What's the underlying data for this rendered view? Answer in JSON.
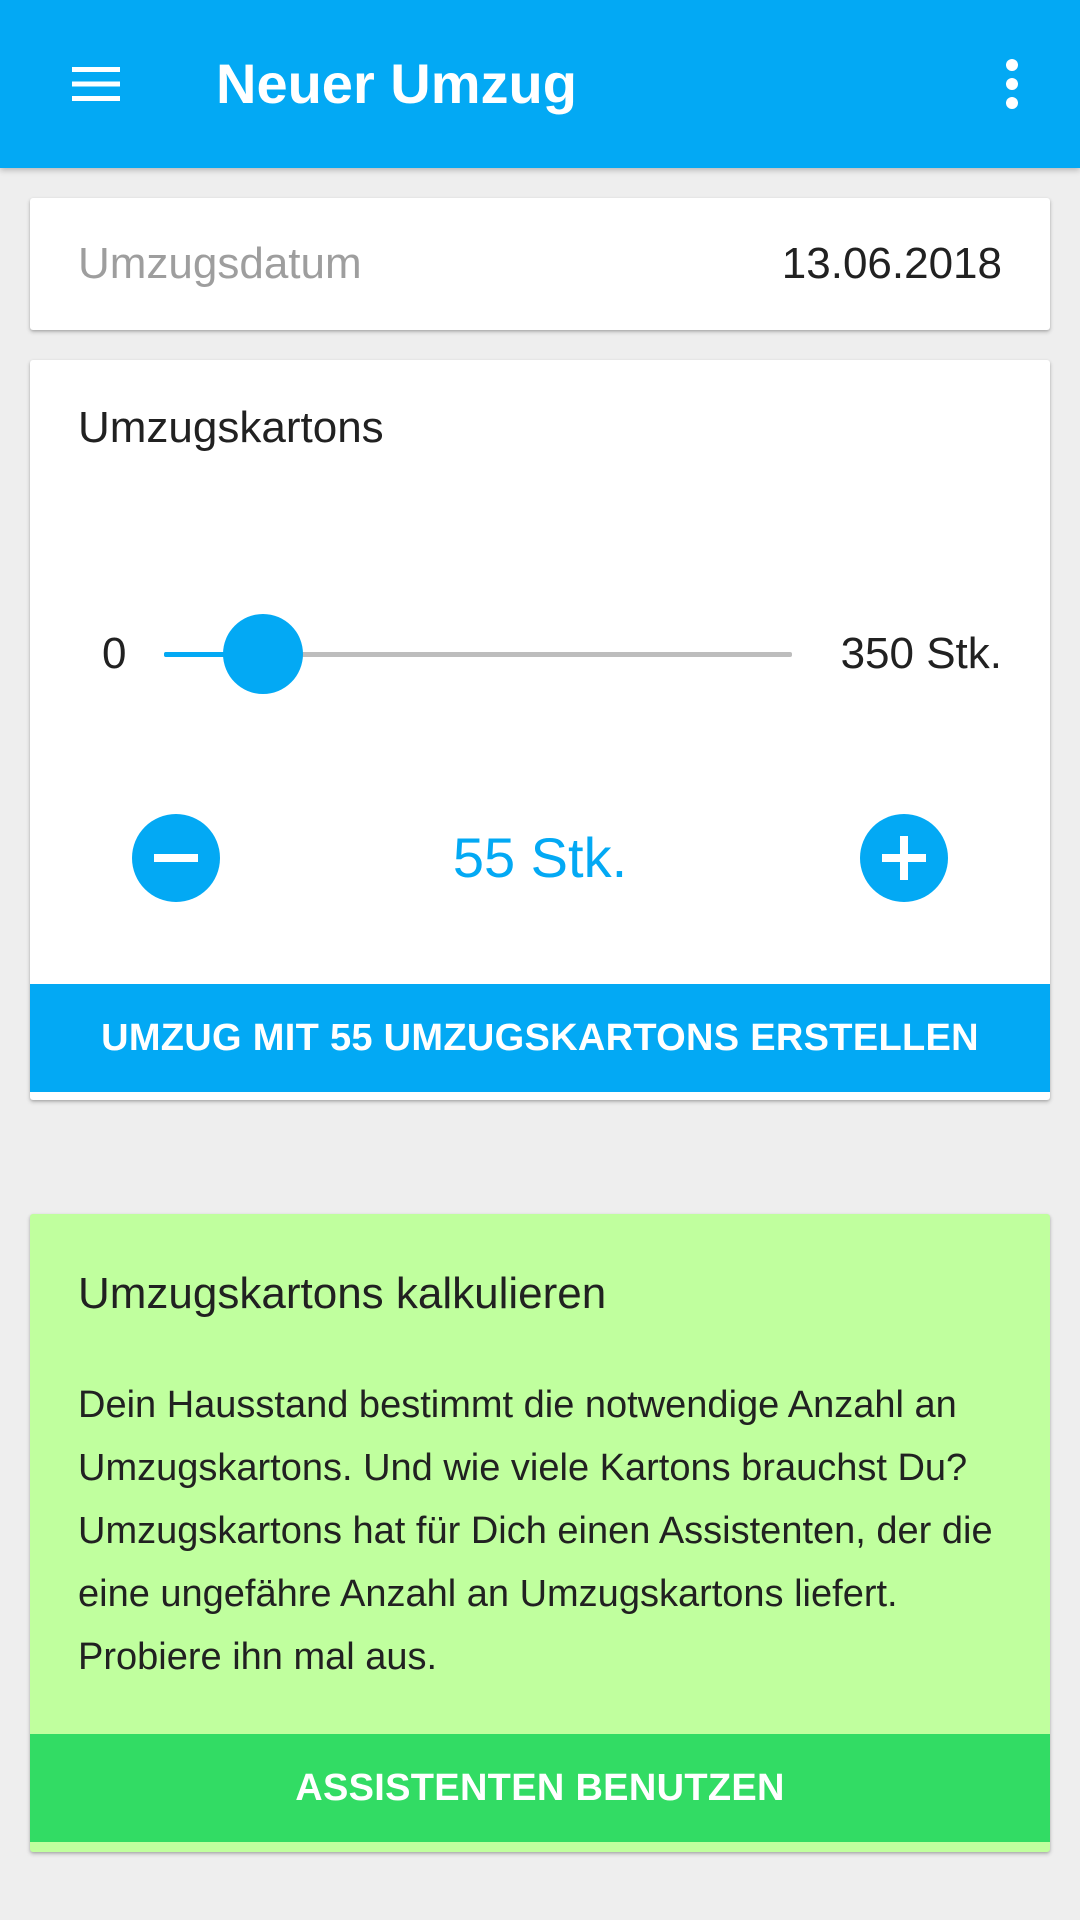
{
  "app_bar": {
    "title": "Neuer Umzug",
    "menu_icon": "hamburger-menu-icon",
    "overflow_icon": "more-vert-icon",
    "color": "#03a9f4"
  },
  "move_date": {
    "label": "Umzugsdatum",
    "value": "13.06.2018"
  },
  "boxes": {
    "title": "Umzugskartons",
    "slider": {
      "min_label": "0",
      "max_label": "350 Stk.",
      "min": 0,
      "max": 350,
      "value": 55
    },
    "decrement_icon": "minus-circle-icon",
    "increment_icon": "plus-circle-icon",
    "count_label": "55 Stk.",
    "create_button_label": "UMZUG MIT 55 UMZUGSKARTONS ERSTELLEN",
    "accent": "#03a9f4"
  },
  "calculator": {
    "title": "Umzugskartons kalkulieren",
    "text": "Dein Hausstand bestimmt die notwendige Anzahl an Umzugskartons. Und wie viele Kartons brauchst Du? Umzugskartons hat für Dich einen Assistenten, der die eine ungefähre Anzahl an Umzugskartons liefert. Probiere ihn mal aus.",
    "button_label": "ASSISTENTEN BENUTZEN",
    "background": "#c0ff9e",
    "button_color": "#32dc64"
  }
}
